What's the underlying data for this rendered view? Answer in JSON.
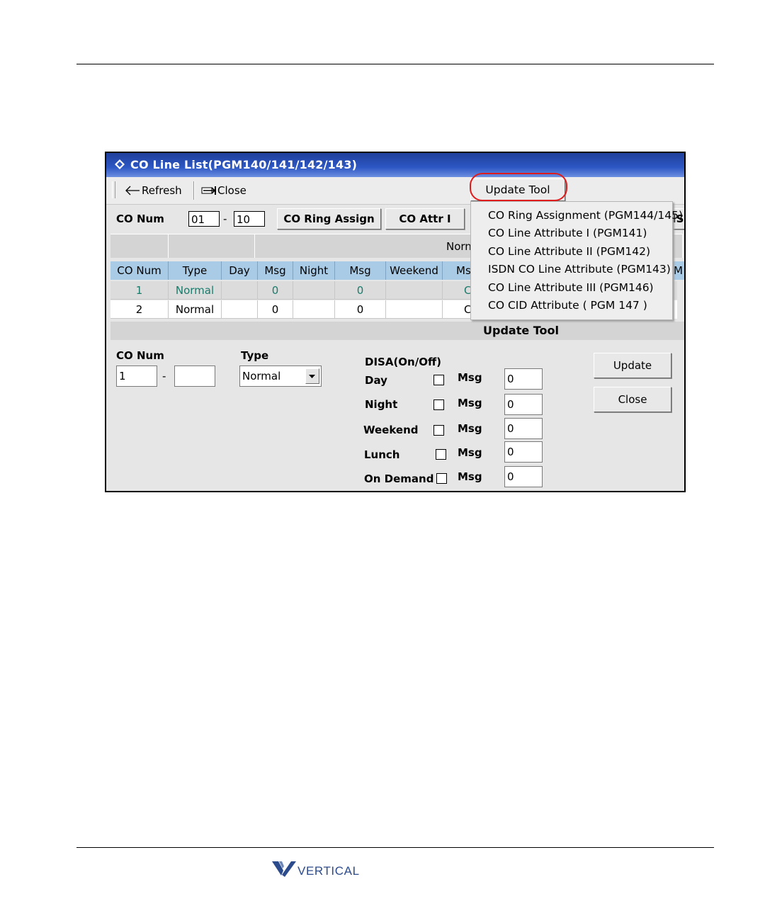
{
  "window": {
    "title": "CO Line List(PGM140/141/142/143)"
  },
  "toolbar": {
    "refresh_label": "Refresh",
    "close_label": "Close",
    "update_tool_label": "Update Tool"
  },
  "filter": {
    "co_num_label": "CO Num",
    "from_value": "01",
    "dash": "-",
    "to_value": "10",
    "ring_assign_label": "CO Ring Assign",
    "attr_label": "CO Attr I",
    "cut_label": "IS"
  },
  "table": {
    "group_label": "Norn",
    "headers": [
      "CO Num",
      "Type",
      "Day",
      "Msg",
      "Night",
      "Msg",
      "Weekend",
      "Ms",
      "M"
    ],
    "rows": [
      [
        "1",
        "Normal",
        "",
        "0",
        "",
        "0",
        "",
        "C"
      ],
      [
        "2",
        "Normal",
        "",
        "0",
        "",
        "0",
        "",
        "C"
      ]
    ]
  },
  "dropdown_menu": {
    "items": [
      "CO Ring Assignment (PGM144/145)",
      "CO Line Attribute I (PGM141)",
      "CO Line Attribute II (PGM142)",
      "ISDN CO Line Attribute (PGM143)",
      "CO Line Attribute III (PGM146)",
      "CO CID Attribute ( PGM 147 )"
    ]
  },
  "update_panel": {
    "header": "Update Tool",
    "co_num_label": "CO Num",
    "from_value": "1",
    "dash": "-",
    "to_value": "",
    "type_label": "Type",
    "type_value": "Normal",
    "disa_label": "DISA(On/Off)",
    "msg_label": "Msg",
    "modes": [
      {
        "label": "Day",
        "checked": false,
        "msg": "0"
      },
      {
        "label": "Night",
        "checked": false,
        "msg": "0"
      },
      {
        "label": "Weekend",
        "checked": false,
        "msg": "0"
      },
      {
        "label": "Lunch",
        "checked": false,
        "msg": "0"
      },
      {
        "label": "On Demand",
        "checked": false,
        "msg": "0"
      }
    ],
    "update_label": "Update",
    "close_label": "Close"
  },
  "footer": {
    "logo_text": "VERTICAL"
  },
  "colors": {
    "title_bar": "#2d57c4",
    "header_row": "#a9cbe6",
    "selected_row_text": "#1b7a6a",
    "highlight_circle": "#e01b1b"
  }
}
